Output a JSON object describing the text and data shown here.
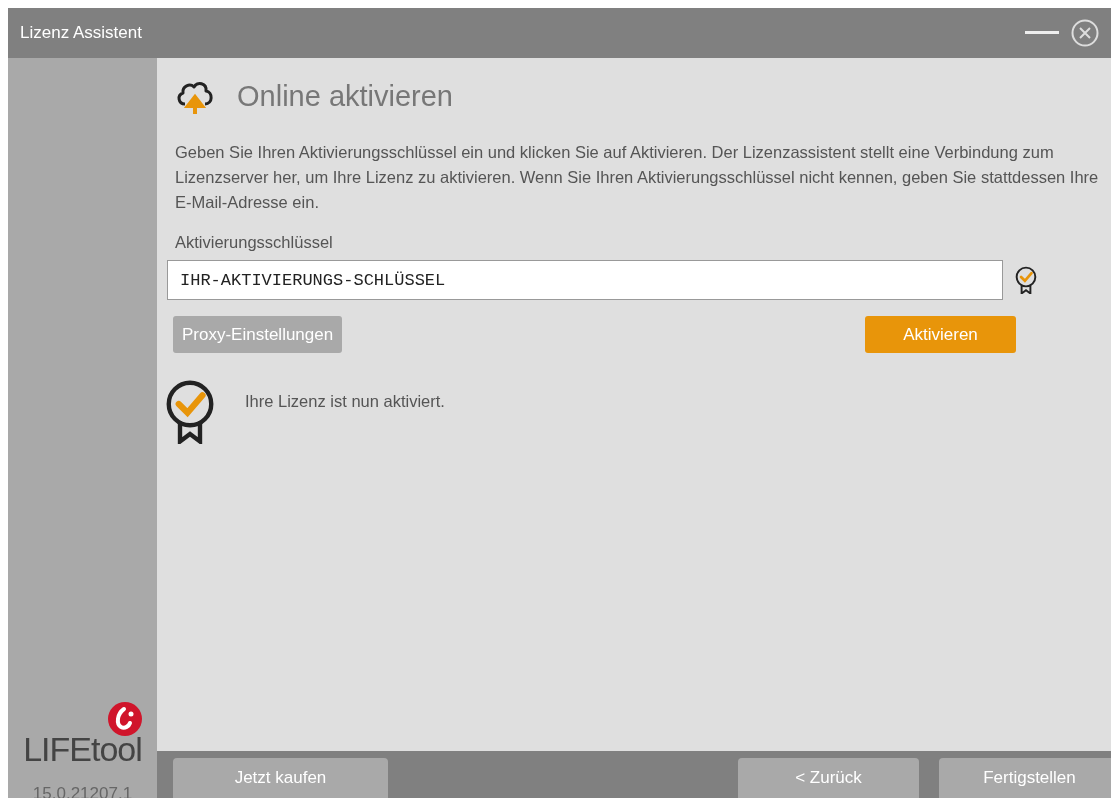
{
  "window": {
    "title": "Lizenz Assistent"
  },
  "sidebar": {
    "logo": "LIFEtool",
    "version": "15.0.21207.1"
  },
  "page": {
    "heading": "Online aktivieren",
    "description": "Geben Sie Ihren Aktivierungsschlüssel ein und klicken Sie auf Aktivieren. Der Lizenzassistent stellt eine Verbindung zum Lizenzserver her, um Ihre Lizenz zu aktivieren. Wenn Sie Ihren Aktivierungsschlüssel nicht kennen, geben Sie stattdessen Ihre E-Mail-Adresse ein.",
    "key_label": "Aktivierungsschlüssel",
    "key_value": "IHR-AKTIVIERUNGS-SCHLÜSSEL",
    "key_valid": true,
    "proxy_button": "Proxy-Einstellungen",
    "activate_button": "Aktivieren",
    "status": "Ihre Lizenz ist nun aktiviert.",
    "activated": true
  },
  "footer": {
    "buttons": [
      {
        "label": "Jetzt kaufen",
        "kind": "left"
      },
      {
        "label": "< Zurück",
        "kind": "right"
      },
      {
        "label": "Fertigstellen",
        "kind": "right"
      }
    ]
  }
}
